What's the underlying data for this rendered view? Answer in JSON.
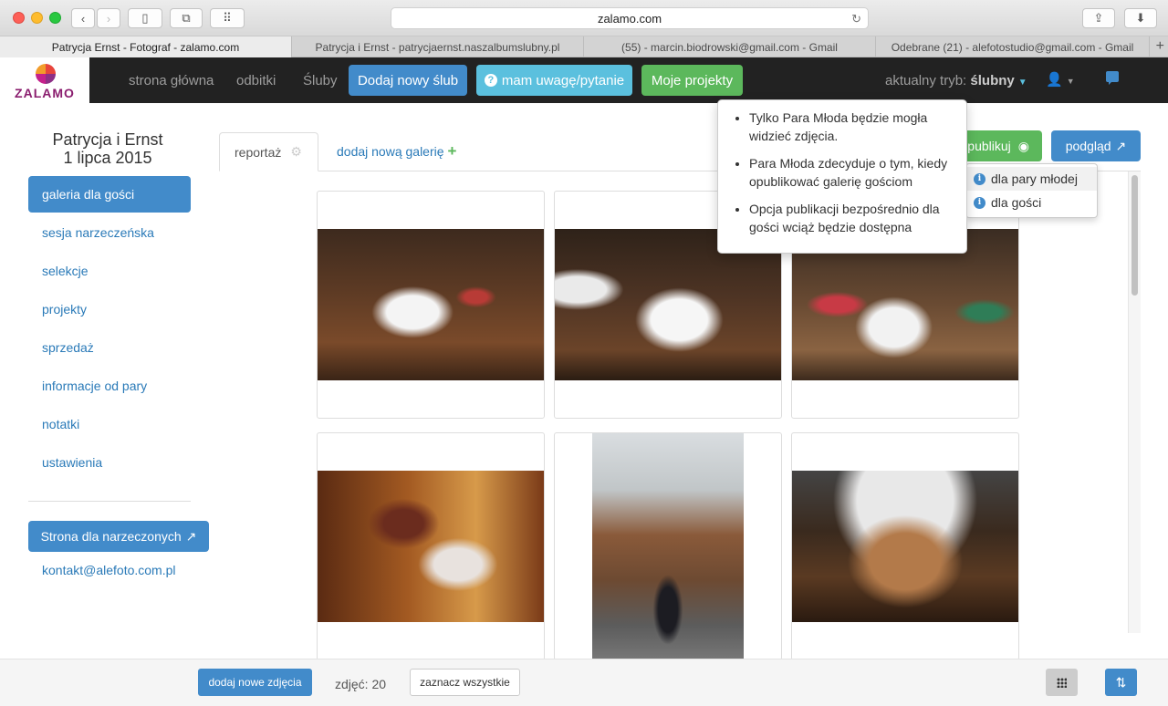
{
  "browser": {
    "url": "zalamo.com",
    "tabs": [
      {
        "label": "Patrycja Ernst - Fotograf - zalamo.com",
        "active": true
      },
      {
        "label": "Patrycja i Ernst - patrycjaernst.naszalbumslubny.pl",
        "active": false
      },
      {
        "label": "(55) - marcin.biodrowski@gmail.com - Gmail",
        "active": false
      },
      {
        "label": "Odebrane (21) - alefotostudio@gmail.com - Gmail",
        "active": false
      }
    ]
  },
  "navbar": {
    "logo_text": "ZALAMO",
    "links": [
      "strona główna",
      "odbitki",
      "Śluby"
    ],
    "add_wedding": "Dodaj nowy ślub",
    "question": "mam uwagę/pytanie",
    "projects": "Moje projekty",
    "mode_label": "aktualny tryb:",
    "mode_value": "ślubny"
  },
  "sidebar": {
    "couple_name": "Patrycja i Ernst",
    "wedding_date": "1 lipca 2015",
    "items": [
      {
        "label": "galeria dla gości",
        "active": true
      },
      {
        "label": "sesja narzeczeńska",
        "active": false
      },
      {
        "label": "selekcje",
        "active": false
      },
      {
        "label": "projekty",
        "active": false
      },
      {
        "label": "sprzedaż",
        "active": false
      },
      {
        "label": "informacje od pary",
        "active": false
      },
      {
        "label": "notatki",
        "active": false
      },
      {
        "label": "ustawienia",
        "active": false
      }
    ],
    "couple_page_button": "Strona dla narzeczonych",
    "contact_email": "kontakt@alefoto.com.pl"
  },
  "gallery": {
    "tab_label": "reportaż",
    "add_gallery": "dodaj nową galerię",
    "publish_button": "publikuj",
    "preview_button": "podgląd",
    "publish_menu": [
      "dla pary młodej",
      "dla gości"
    ],
    "tooltip": [
      "Tylko Para Młoda będzie mogła widzieć zdjęcia.",
      "Para Młoda zdecyduje o tym, kiedy opublikować galerię gościom",
      "Opcja publikacji bezpośrednio dla gości wciąż będzie dostępna"
    ]
  },
  "footer": {
    "add_photos": "dodaj nowe zdjęcia",
    "photo_count": "zdjęć: 20",
    "select_all": "zaznacz wszystkie"
  }
}
